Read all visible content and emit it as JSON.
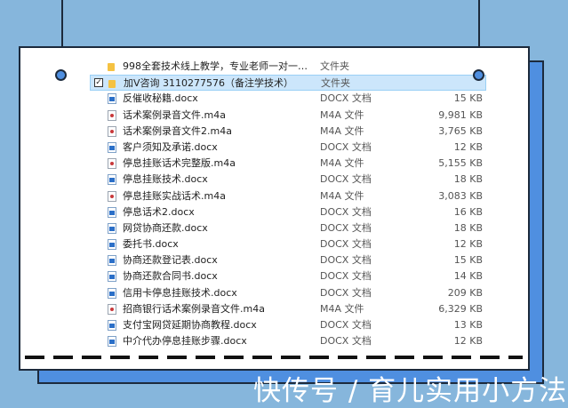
{
  "files": [
    {
      "name": "998全套技术线上教学，专业老师一对一指...",
      "type": "文件夹",
      "size": "",
      "icon": "folder-icon",
      "kind": "folder",
      "selected": false
    },
    {
      "name": "加V咨询 3110277576（备注学技术）",
      "type": "文件夹",
      "size": "",
      "icon": "folder-icon",
      "kind": "folder",
      "selected": true
    },
    {
      "name": "反催收秘籍.docx",
      "type": "DOCX 文档",
      "size": "15 KB",
      "icon": "docx-icon",
      "kind": "doc",
      "selected": false
    },
    {
      "name": "话术案例录音文件.m4a",
      "type": "M4A 文件",
      "size": "9,981 KB",
      "icon": "audio-icon",
      "kind": "audio",
      "selected": false
    },
    {
      "name": "话术案例录音文件2.m4a",
      "type": "M4A 文件",
      "size": "3,765 KB",
      "icon": "audio-icon",
      "kind": "audio",
      "selected": false
    },
    {
      "name": "客户须知及承诺.docx",
      "type": "DOCX 文档",
      "size": "12 KB",
      "icon": "docx-icon",
      "kind": "doc",
      "selected": false
    },
    {
      "name": "停息挂账话术完整版.m4a",
      "type": "M4A 文件",
      "size": "5,155 KB",
      "icon": "audio-icon",
      "kind": "audio",
      "selected": false
    },
    {
      "name": "停息挂账技术.docx",
      "type": "DOCX 文档",
      "size": "18 KB",
      "icon": "docx-icon",
      "kind": "doc",
      "selected": false
    },
    {
      "name": "停息挂账实战话术.m4a",
      "type": "M4A 文件",
      "size": "3,083 KB",
      "icon": "audio-icon",
      "kind": "audio",
      "selected": false
    },
    {
      "name": "停息话术2.docx",
      "type": "DOCX 文档",
      "size": "16 KB",
      "icon": "docx-icon",
      "kind": "doc",
      "selected": false
    },
    {
      "name": "网贷协商还款.docx",
      "type": "DOCX 文档",
      "size": "18 KB",
      "icon": "docx-icon",
      "kind": "doc",
      "selected": false
    },
    {
      "name": "委托书.docx",
      "type": "DOCX 文档",
      "size": "12 KB",
      "icon": "docx-icon",
      "kind": "doc",
      "selected": false
    },
    {
      "name": "协商还款登记表.docx",
      "type": "DOCX 文档",
      "size": "15 KB",
      "icon": "docx-icon",
      "kind": "doc",
      "selected": false
    },
    {
      "name": "协商还款合同书.docx",
      "type": "DOCX 文档",
      "size": "14 KB",
      "icon": "docx-icon",
      "kind": "doc",
      "selected": false
    },
    {
      "name": "信用卡停息挂账技术.docx",
      "type": "DOCX 文档",
      "size": "209 KB",
      "icon": "docx-icon",
      "kind": "doc",
      "selected": false
    },
    {
      "name": "招商银行话术案例录音文件.m4a",
      "type": "M4A 文件",
      "size": "6,329 KB",
      "icon": "audio-icon",
      "kind": "audio",
      "selected": false
    },
    {
      "name": "支付宝网贷延期协商教程.docx",
      "type": "DOCX 文档",
      "size": "13 KB",
      "icon": "docx-icon",
      "kind": "doc",
      "selected": false
    },
    {
      "name": "中介代办停息挂账步骤.docx",
      "type": "DOCX 文档",
      "size": "12 KB",
      "icon": "docx-icon",
      "kind": "doc",
      "selected": false
    }
  ],
  "checkbox_mark": "✓",
  "watermark": "快传号 / 育儿实用小方法",
  "colors": {
    "background": "#86b6dc",
    "accent": "#4f8fe0",
    "selection": "#cce6fb",
    "outline": "#1c2a3c"
  }
}
